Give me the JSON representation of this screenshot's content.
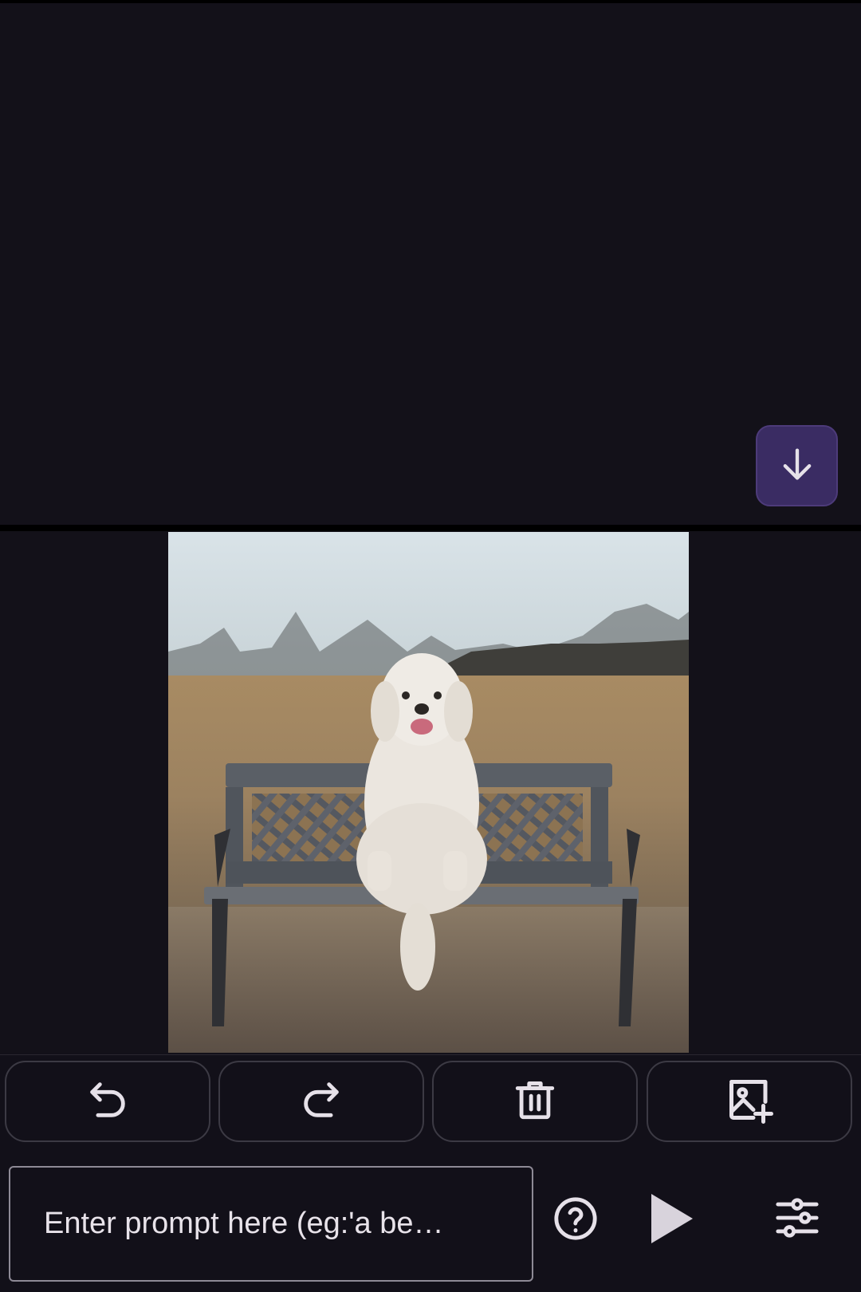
{
  "colors": {
    "background": "#131119",
    "accent": "#3a2c63",
    "icon": "#e6e1e9",
    "outline": "#3c3a44"
  },
  "top": {
    "scroll_button_icon": "arrow-down-icon"
  },
  "canvas": {
    "image_subject": "white-doodle-dog-on-bench-photo"
  },
  "toolbar": {
    "undo_icon": "undo-icon",
    "redo_icon": "redo-icon",
    "delete_icon": "trash-icon",
    "add_image_icon": "add-image-icon"
  },
  "prompt": {
    "placeholder": "Enter prompt here (eg:'a be…"
  },
  "actions": {
    "help_icon": "help-circle-icon",
    "run_icon": "play-icon",
    "settings_icon": "sliders-icon"
  }
}
